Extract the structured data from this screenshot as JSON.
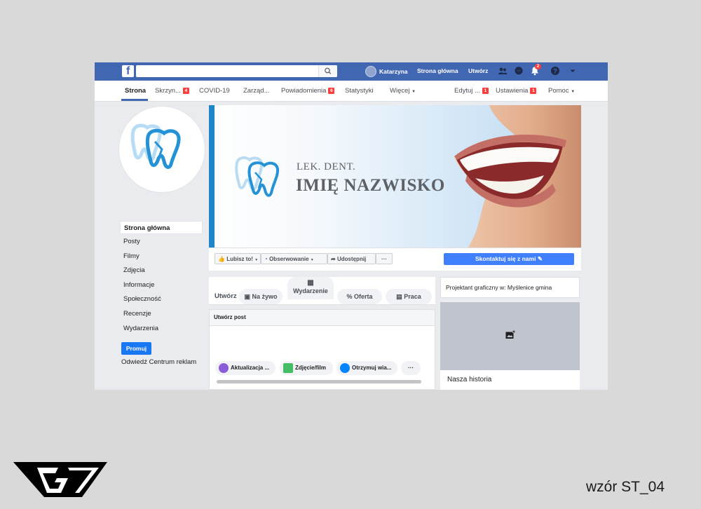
{
  "topbar": {
    "logo": "f",
    "search": {
      "value": "",
      "placeholder": ""
    },
    "user_name": "Katarzyna",
    "home_link": "Strona główna",
    "create_link": "Utwórz",
    "notifications_count": "2",
    "colors": {
      "brand": "#4267b2",
      "accent_button": "#4080ff"
    }
  },
  "pagenav": {
    "items": [
      {
        "label": "Strona",
        "active": true
      },
      {
        "label": "Skrzyn...",
        "badge": "4"
      },
      {
        "label": "COVID-19"
      },
      {
        "label": "Zarząd..."
      },
      {
        "label": "Powiadomienia",
        "badge": "6"
      },
      {
        "label": "Statystyki"
      },
      {
        "label": "Więcej"
      },
      {
        "label": "Edytuj ...",
        "badge": "1"
      },
      {
        "label": "Ustawienia",
        "badge": "1"
      },
      {
        "label": "Pomoc"
      }
    ]
  },
  "sidebar": {
    "items": [
      "Strona główna",
      "Posty",
      "Filmy",
      "Zdjęcia",
      "Informacje",
      "Społeczność",
      "Recenzje",
      "Wydarzenia"
    ],
    "promote": "Promuj",
    "ad_center": "Odwiedź Centrum reklam"
  },
  "cover": {
    "line1": "LEK. DENT.",
    "line2": "IMIĘ NAZWISKO"
  },
  "actions": {
    "like": "Lubisz to!",
    "follow": "Obserwowanie",
    "share": "Udostępnij",
    "more": "···",
    "contact": "Skontaktuj się z nami"
  },
  "create_bar": {
    "title": "Utwórz",
    "live": "Na żywo",
    "event": "Wydarzenie",
    "offer": "Oferta",
    "job": "Praca"
  },
  "create_post": {
    "header": "Utwórz post",
    "update": "Aktualizacja ...",
    "photo": "Zdjęcie/film",
    "messages": "Otrzymuj wia...",
    "more": "···"
  },
  "right": {
    "designer": "Projektant graficzny w: Myślenice gmina",
    "story": "Nasza historia"
  },
  "caption": "wzór ST_04"
}
